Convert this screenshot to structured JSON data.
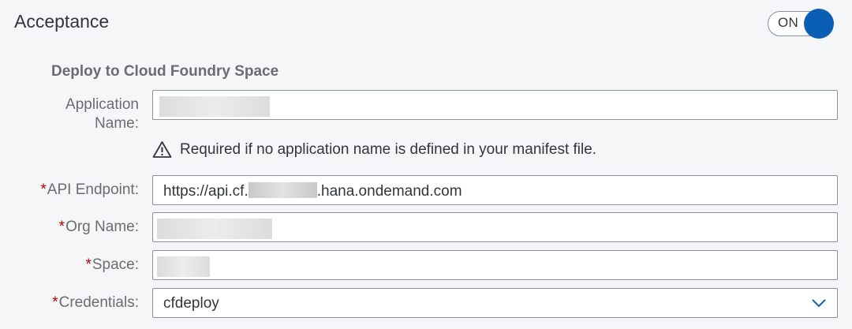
{
  "section": {
    "title": "Acceptance"
  },
  "toggle": {
    "label": "ON",
    "state": "on",
    "accent": "#0a5fb4"
  },
  "group": {
    "title": "Deploy to Cloud Foundry Space"
  },
  "fields": {
    "app_name": {
      "label": "Application Name:",
      "label_line1": "Application",
      "label_line2": "Name:",
      "value": "",
      "redacted": true
    },
    "app_name_hint": {
      "icon": "warning-icon",
      "text": "Required if no application name is defined in your manifest file."
    },
    "api_endpoint": {
      "required_mark": "*",
      "label": "API Endpoint:",
      "value_prefix": "https://api.cf.",
      "value_suffix": ".hana.ondemand.com",
      "redacted_middle": true
    },
    "org_name": {
      "required_mark": "*",
      "label": "Org Name:",
      "value": "",
      "redacted": true
    },
    "space": {
      "required_mark": "*",
      "label": "Space:",
      "value": "",
      "redacted": true
    },
    "credentials": {
      "required_mark": "*",
      "label": "Credentials:",
      "value": "cfdeploy",
      "icon": "chevron-down-icon"
    }
  },
  "colors": {
    "required": "#bb0000",
    "label": "#6a6d70",
    "border": "#89919a",
    "background": "#f5f6f7"
  }
}
